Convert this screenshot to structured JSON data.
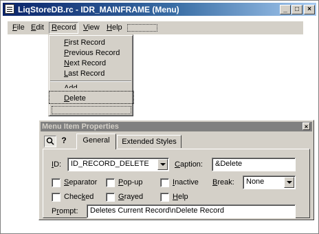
{
  "window": {
    "title": "LiqStoreDB.rc - IDR_MAINFRAME (Menu)",
    "buttons": {
      "minimize": "_",
      "maximize": "□",
      "close": "×"
    }
  },
  "menubar": {
    "items": [
      {
        "label": "File",
        "mnemonic": "F",
        "rest": "ile"
      },
      {
        "label": "Edit",
        "mnemonic": "E",
        "rest": "dit"
      },
      {
        "label": "Record",
        "mnemonic": "R",
        "rest": "ecord"
      },
      {
        "label": "View",
        "mnemonic": "V",
        "rest": "iew"
      },
      {
        "label": "Help",
        "mnemonic": "H",
        "rest": "elp"
      }
    ]
  },
  "dropdown": {
    "items": [
      {
        "label": "First Record",
        "mnemonic": "F",
        "rest": "irst Record"
      },
      {
        "label": "Previous Record",
        "mnemonic": "P",
        "rest": "revious Record"
      },
      {
        "label": "Next Record",
        "mnemonic": "N",
        "rest": "ext Record"
      },
      {
        "label": "Last Record",
        "mnemonic": "L",
        "rest": "ast Record"
      },
      {
        "label": "Add",
        "mnemonic": "A",
        "rest": "dd"
      },
      {
        "label": "Delete",
        "mnemonic": "D",
        "rest": "elete"
      }
    ]
  },
  "properties": {
    "title": "Menu Item Properties",
    "close": "×",
    "tabs": [
      "General",
      "Extended Styles"
    ],
    "id_label_m": "I",
    "id_label_rest": "D:",
    "id_value": "ID_RECORD_DELETE",
    "caption_label_m": "C",
    "caption_label_rest": "aption:",
    "caption_value": "&Delete",
    "checkboxes": [
      {
        "pre": "",
        "m": "S",
        "rest": "eparator"
      },
      {
        "pre": "",
        "m": "P",
        "rest": "op-up"
      },
      {
        "pre": "",
        "m": "I",
        "rest": "nactive"
      },
      {
        "pre": "Chec",
        "m": "k",
        "rest": "ed"
      },
      {
        "pre": "",
        "m": "G",
        "rest": "rayed"
      },
      {
        "pre": "",
        "m": "H",
        "rest": "elp"
      }
    ],
    "break_label_m": "B",
    "break_label_rest": "reak:",
    "break_value": "None",
    "prompt_label_pre": "P",
    "prompt_label_m": "r",
    "prompt_label_rest": "ompt:",
    "prompt_value": "Deletes Current Record\\nDelete Record"
  },
  "icons": {
    "pin": "pin-icon",
    "help": "question-icon",
    "app": "menu-resource-icon"
  }
}
